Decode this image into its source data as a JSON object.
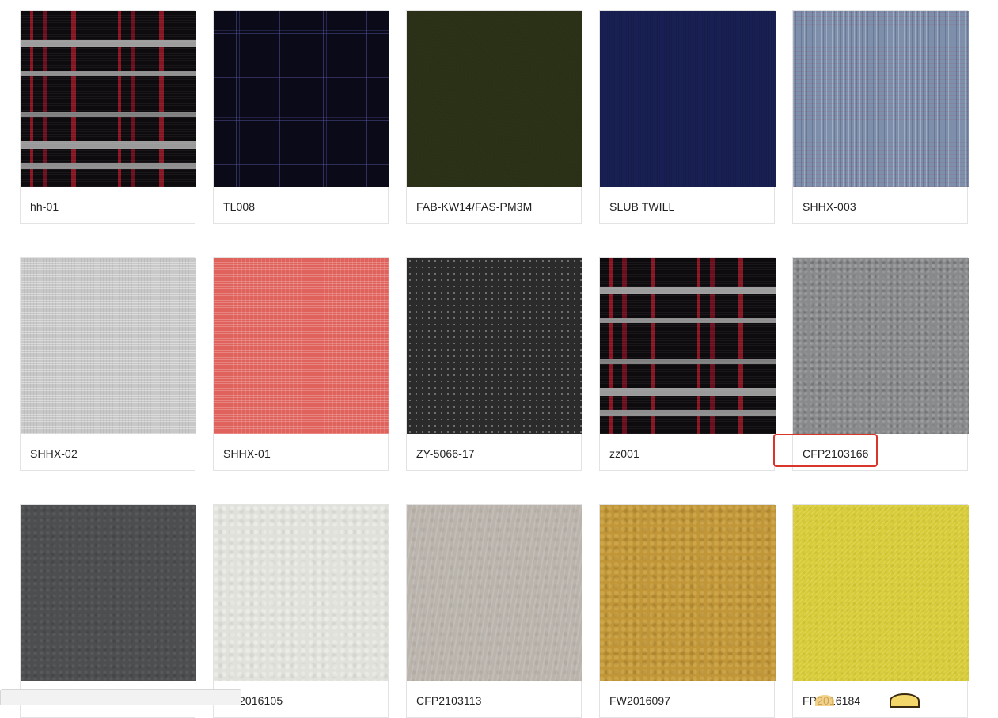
{
  "fabrics": [
    {
      "code": "hh-01",
      "texture": "plaid-black-red-grey"
    },
    {
      "code": "TL008",
      "texture": "dark-navy-check"
    },
    {
      "code": "FAB-KW14/FAS-PM3M",
      "texture": "olive-solid"
    },
    {
      "code": "SLUB TWILL",
      "texture": "navy-solid"
    },
    {
      "code": "SHHX-003",
      "texture": "blue-melange"
    },
    {
      "code": "SHHX-02",
      "texture": "light-grey-melange"
    },
    {
      "code": "SHHX-01",
      "texture": "red-melange"
    },
    {
      "code": "ZY-5066-17",
      "texture": "black-dot"
    },
    {
      "code": "zz001",
      "texture": "plaid-black-red-grey"
    },
    {
      "code": "CFP2103166",
      "texture": "grey-fleece"
    },
    {
      "code": "",
      "texture": "charcoal-wool"
    },
    {
      "code": "2016105",
      "texture": "cream-wool"
    },
    {
      "code": "CFP2103113",
      "texture": "beige-wool"
    },
    {
      "code": "FW2016097",
      "texture": "mustard-wool"
    },
    {
      "code": "FP2016184",
      "texture": "yellow-wool"
    }
  ],
  "highlight_color": "#d9352a"
}
